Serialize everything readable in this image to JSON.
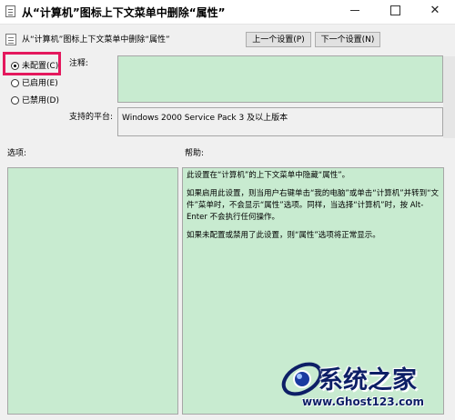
{
  "window": {
    "title": "从“计算机”图标上下文菜单中删除“属性”",
    "minimize_icon": "minimize-icon",
    "maximize_icon": "maximize-icon",
    "close_icon": "close-icon",
    "close_glyph": "✕"
  },
  "header": {
    "policy_name": "从“计算机”图标上下文菜单中删除“属性”",
    "prev_button": "上一个设置(P)",
    "next_button": "下一个设置(N)"
  },
  "options": {
    "items": [
      {
        "label": "未配置(C)",
        "selected": true
      },
      {
        "label": "已启用(E)",
        "selected": false
      },
      {
        "label": "已禁用(D)",
        "selected": false
      }
    ]
  },
  "comment": {
    "label": "注释:",
    "value": ""
  },
  "platform": {
    "label": "支持的平台:",
    "value": "Windows 2000 Service Pack 3 及以上版本"
  },
  "panels": {
    "options_label": "选项:",
    "help_label": "帮助:",
    "help_paragraphs": [
      "此设置在“计算机”的上下文菜单中隐藏“属性”。",
      "如果启用此设置，则当用户右键单击“我的电脑”或单击“计算机”并转到“文件”菜单时，不会显示“属性”选项。同样，当选择“计算机”时，按 Alt-Enter 不会执行任何操作。",
      "如果未配置或禁用了此设置，则“属性”选项将正常显示。"
    ]
  },
  "watermark": {
    "site_name": "系统之家",
    "url": "www.Ghost123.com"
  },
  "colors": {
    "highlight_border": "#e4185d",
    "panel_green": "#c8ebd0",
    "watermark_blue": "#0d1f66"
  }
}
